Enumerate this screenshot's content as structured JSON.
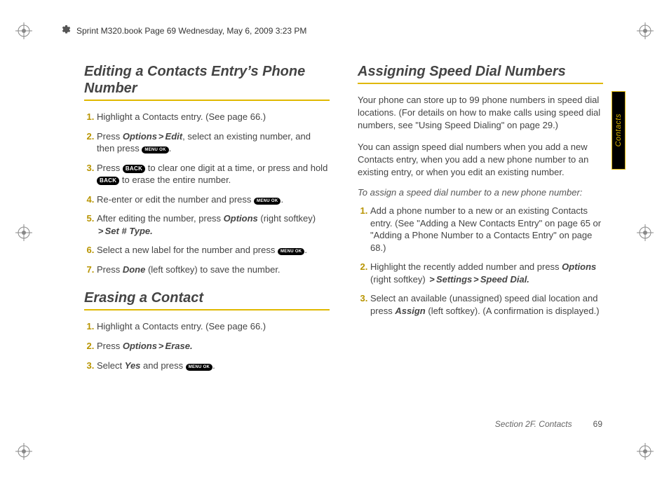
{
  "header": {
    "text": "Sprint M320.book  Page 69  Wednesday, May 6, 2009  3:23 PM"
  },
  "sideTab": "Contacts",
  "footer": {
    "section": "Section 2F. Contacts",
    "page": "69"
  },
  "keys": {
    "menu": "MENU\nOK",
    "back": "BACK"
  },
  "left": {
    "h1": "Editing a Contacts Entry’s Phone Number",
    "steps1": [
      {
        "pre": "Highlight a Contacts entry. (See page 66.)"
      },
      {
        "pre": "Press ",
        "label1": "Options",
        "gt1": ">",
        "label2": "Edit",
        "post1": ", select an existing number, and then press ",
        "key1": "menu",
        "post2": "."
      },
      {
        "pre": "Press ",
        "key1": "back",
        "mid": " to clear one digit at a time, or press and hold ",
        "key2": "back",
        "post": " to erase the entire number."
      },
      {
        "pre": "Re-enter or edit the number and press ",
        "key1": "menu",
        "post": "."
      },
      {
        "pre": "After editing the number, press ",
        "label1": "Options",
        "post1": " (right softkey) ",
        "gt1": ">",
        "label2": "Set # Type.",
        "post2": ""
      },
      {
        "pre": "Select a new label for the number and press ",
        "key1": "menu",
        "post": "."
      },
      {
        "pre": "Press ",
        "label1": "Done",
        "post1": " (left softkey) to save the number."
      }
    ],
    "h2": "Erasing a Contact",
    "steps2": [
      {
        "pre": "Highlight a Contacts entry. (See page 66.)"
      },
      {
        "pre": "Press ",
        "label1": "Options",
        "gt1": ">",
        "label2": "Erase.",
        "post1": ""
      },
      {
        "pre": "Select ",
        "label1": "Yes",
        "post1": " and press ",
        "key1": "menu",
        "post2": "."
      }
    ]
  },
  "right": {
    "h1": "Assigning Speed Dial Numbers",
    "p1": "Your phone can store up to 99 phone numbers in speed dial locations. (For details on how to make calls using speed dial numbers, see \"Using Speed Dialing\" on page 29.)",
    "p2": "You can assign speed dial numbers when you add a new Contacts entry, when you add a new phone number to an existing entry, or when you edit an existing number.",
    "sub": "To assign a speed dial number to a new phone number:",
    "steps": [
      {
        "pre": "Add a phone number to a new or an existing Contacts entry. (See \"Adding a New Contacts Entry\" on page 65 or \"Adding a Phone Number to a Contacts Entry\" on page 68.)"
      },
      {
        "pre": "Highlight the recently added number and press ",
        "label1": "Options",
        "post1": " (right softkey) ",
        "gt1": ">",
        "label2": "Settings",
        "gt2": ">",
        "label3": "Speed Dial.",
        "post2": ""
      },
      {
        "pre": "Select an available (unassigned) speed dial location and press ",
        "label1": "Assign",
        "post1": " (left softkey). (A confirmation is displayed.)"
      }
    ]
  }
}
